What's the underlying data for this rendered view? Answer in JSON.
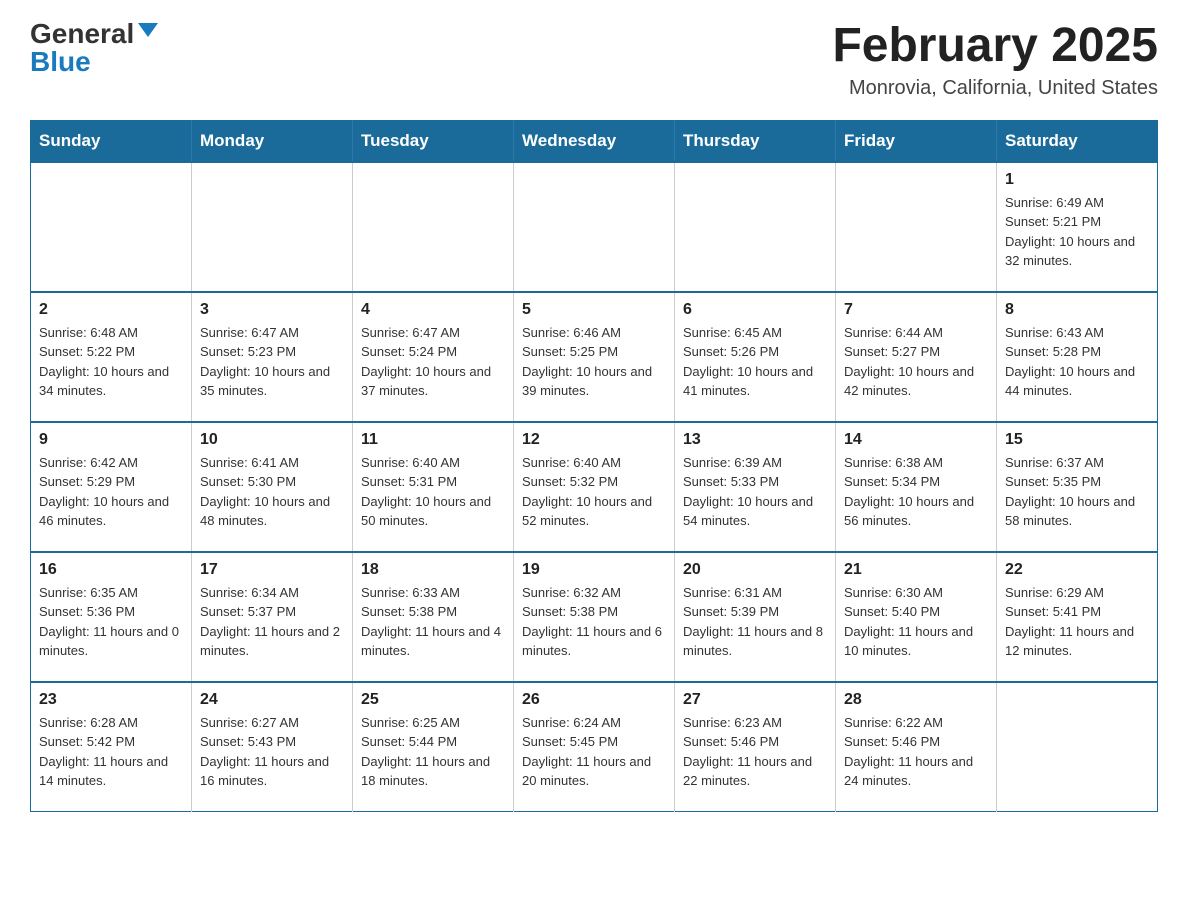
{
  "logo": {
    "general": "General",
    "blue": "Blue",
    "arrow": "▼"
  },
  "title": "February 2025",
  "location": "Monrovia, California, United States",
  "days_of_week": [
    "Sunday",
    "Monday",
    "Tuesday",
    "Wednesday",
    "Thursday",
    "Friday",
    "Saturday"
  ],
  "weeks": [
    [
      {
        "day": "",
        "info": ""
      },
      {
        "day": "",
        "info": ""
      },
      {
        "day": "",
        "info": ""
      },
      {
        "day": "",
        "info": ""
      },
      {
        "day": "",
        "info": ""
      },
      {
        "day": "",
        "info": ""
      },
      {
        "day": "1",
        "info": "Sunrise: 6:49 AM\nSunset: 5:21 PM\nDaylight: 10 hours and 32 minutes."
      }
    ],
    [
      {
        "day": "2",
        "info": "Sunrise: 6:48 AM\nSunset: 5:22 PM\nDaylight: 10 hours and 34 minutes."
      },
      {
        "day": "3",
        "info": "Sunrise: 6:47 AM\nSunset: 5:23 PM\nDaylight: 10 hours and 35 minutes."
      },
      {
        "day": "4",
        "info": "Sunrise: 6:47 AM\nSunset: 5:24 PM\nDaylight: 10 hours and 37 minutes."
      },
      {
        "day": "5",
        "info": "Sunrise: 6:46 AM\nSunset: 5:25 PM\nDaylight: 10 hours and 39 minutes."
      },
      {
        "day": "6",
        "info": "Sunrise: 6:45 AM\nSunset: 5:26 PM\nDaylight: 10 hours and 41 minutes."
      },
      {
        "day": "7",
        "info": "Sunrise: 6:44 AM\nSunset: 5:27 PM\nDaylight: 10 hours and 42 minutes."
      },
      {
        "day": "8",
        "info": "Sunrise: 6:43 AM\nSunset: 5:28 PM\nDaylight: 10 hours and 44 minutes."
      }
    ],
    [
      {
        "day": "9",
        "info": "Sunrise: 6:42 AM\nSunset: 5:29 PM\nDaylight: 10 hours and 46 minutes."
      },
      {
        "day": "10",
        "info": "Sunrise: 6:41 AM\nSunset: 5:30 PM\nDaylight: 10 hours and 48 minutes."
      },
      {
        "day": "11",
        "info": "Sunrise: 6:40 AM\nSunset: 5:31 PM\nDaylight: 10 hours and 50 minutes."
      },
      {
        "day": "12",
        "info": "Sunrise: 6:40 AM\nSunset: 5:32 PM\nDaylight: 10 hours and 52 minutes."
      },
      {
        "day": "13",
        "info": "Sunrise: 6:39 AM\nSunset: 5:33 PM\nDaylight: 10 hours and 54 minutes."
      },
      {
        "day": "14",
        "info": "Sunrise: 6:38 AM\nSunset: 5:34 PM\nDaylight: 10 hours and 56 minutes."
      },
      {
        "day": "15",
        "info": "Sunrise: 6:37 AM\nSunset: 5:35 PM\nDaylight: 10 hours and 58 minutes."
      }
    ],
    [
      {
        "day": "16",
        "info": "Sunrise: 6:35 AM\nSunset: 5:36 PM\nDaylight: 11 hours and 0 minutes."
      },
      {
        "day": "17",
        "info": "Sunrise: 6:34 AM\nSunset: 5:37 PM\nDaylight: 11 hours and 2 minutes."
      },
      {
        "day": "18",
        "info": "Sunrise: 6:33 AM\nSunset: 5:38 PM\nDaylight: 11 hours and 4 minutes."
      },
      {
        "day": "19",
        "info": "Sunrise: 6:32 AM\nSunset: 5:38 PM\nDaylight: 11 hours and 6 minutes."
      },
      {
        "day": "20",
        "info": "Sunrise: 6:31 AM\nSunset: 5:39 PM\nDaylight: 11 hours and 8 minutes."
      },
      {
        "day": "21",
        "info": "Sunrise: 6:30 AM\nSunset: 5:40 PM\nDaylight: 11 hours and 10 minutes."
      },
      {
        "day": "22",
        "info": "Sunrise: 6:29 AM\nSunset: 5:41 PM\nDaylight: 11 hours and 12 minutes."
      }
    ],
    [
      {
        "day": "23",
        "info": "Sunrise: 6:28 AM\nSunset: 5:42 PM\nDaylight: 11 hours and 14 minutes."
      },
      {
        "day": "24",
        "info": "Sunrise: 6:27 AM\nSunset: 5:43 PM\nDaylight: 11 hours and 16 minutes."
      },
      {
        "day": "25",
        "info": "Sunrise: 6:25 AM\nSunset: 5:44 PM\nDaylight: 11 hours and 18 minutes."
      },
      {
        "day": "26",
        "info": "Sunrise: 6:24 AM\nSunset: 5:45 PM\nDaylight: 11 hours and 20 minutes."
      },
      {
        "day": "27",
        "info": "Sunrise: 6:23 AM\nSunset: 5:46 PM\nDaylight: 11 hours and 22 minutes."
      },
      {
        "day": "28",
        "info": "Sunrise: 6:22 AM\nSunset: 5:46 PM\nDaylight: 11 hours and 24 minutes."
      },
      {
        "day": "",
        "info": ""
      }
    ]
  ]
}
